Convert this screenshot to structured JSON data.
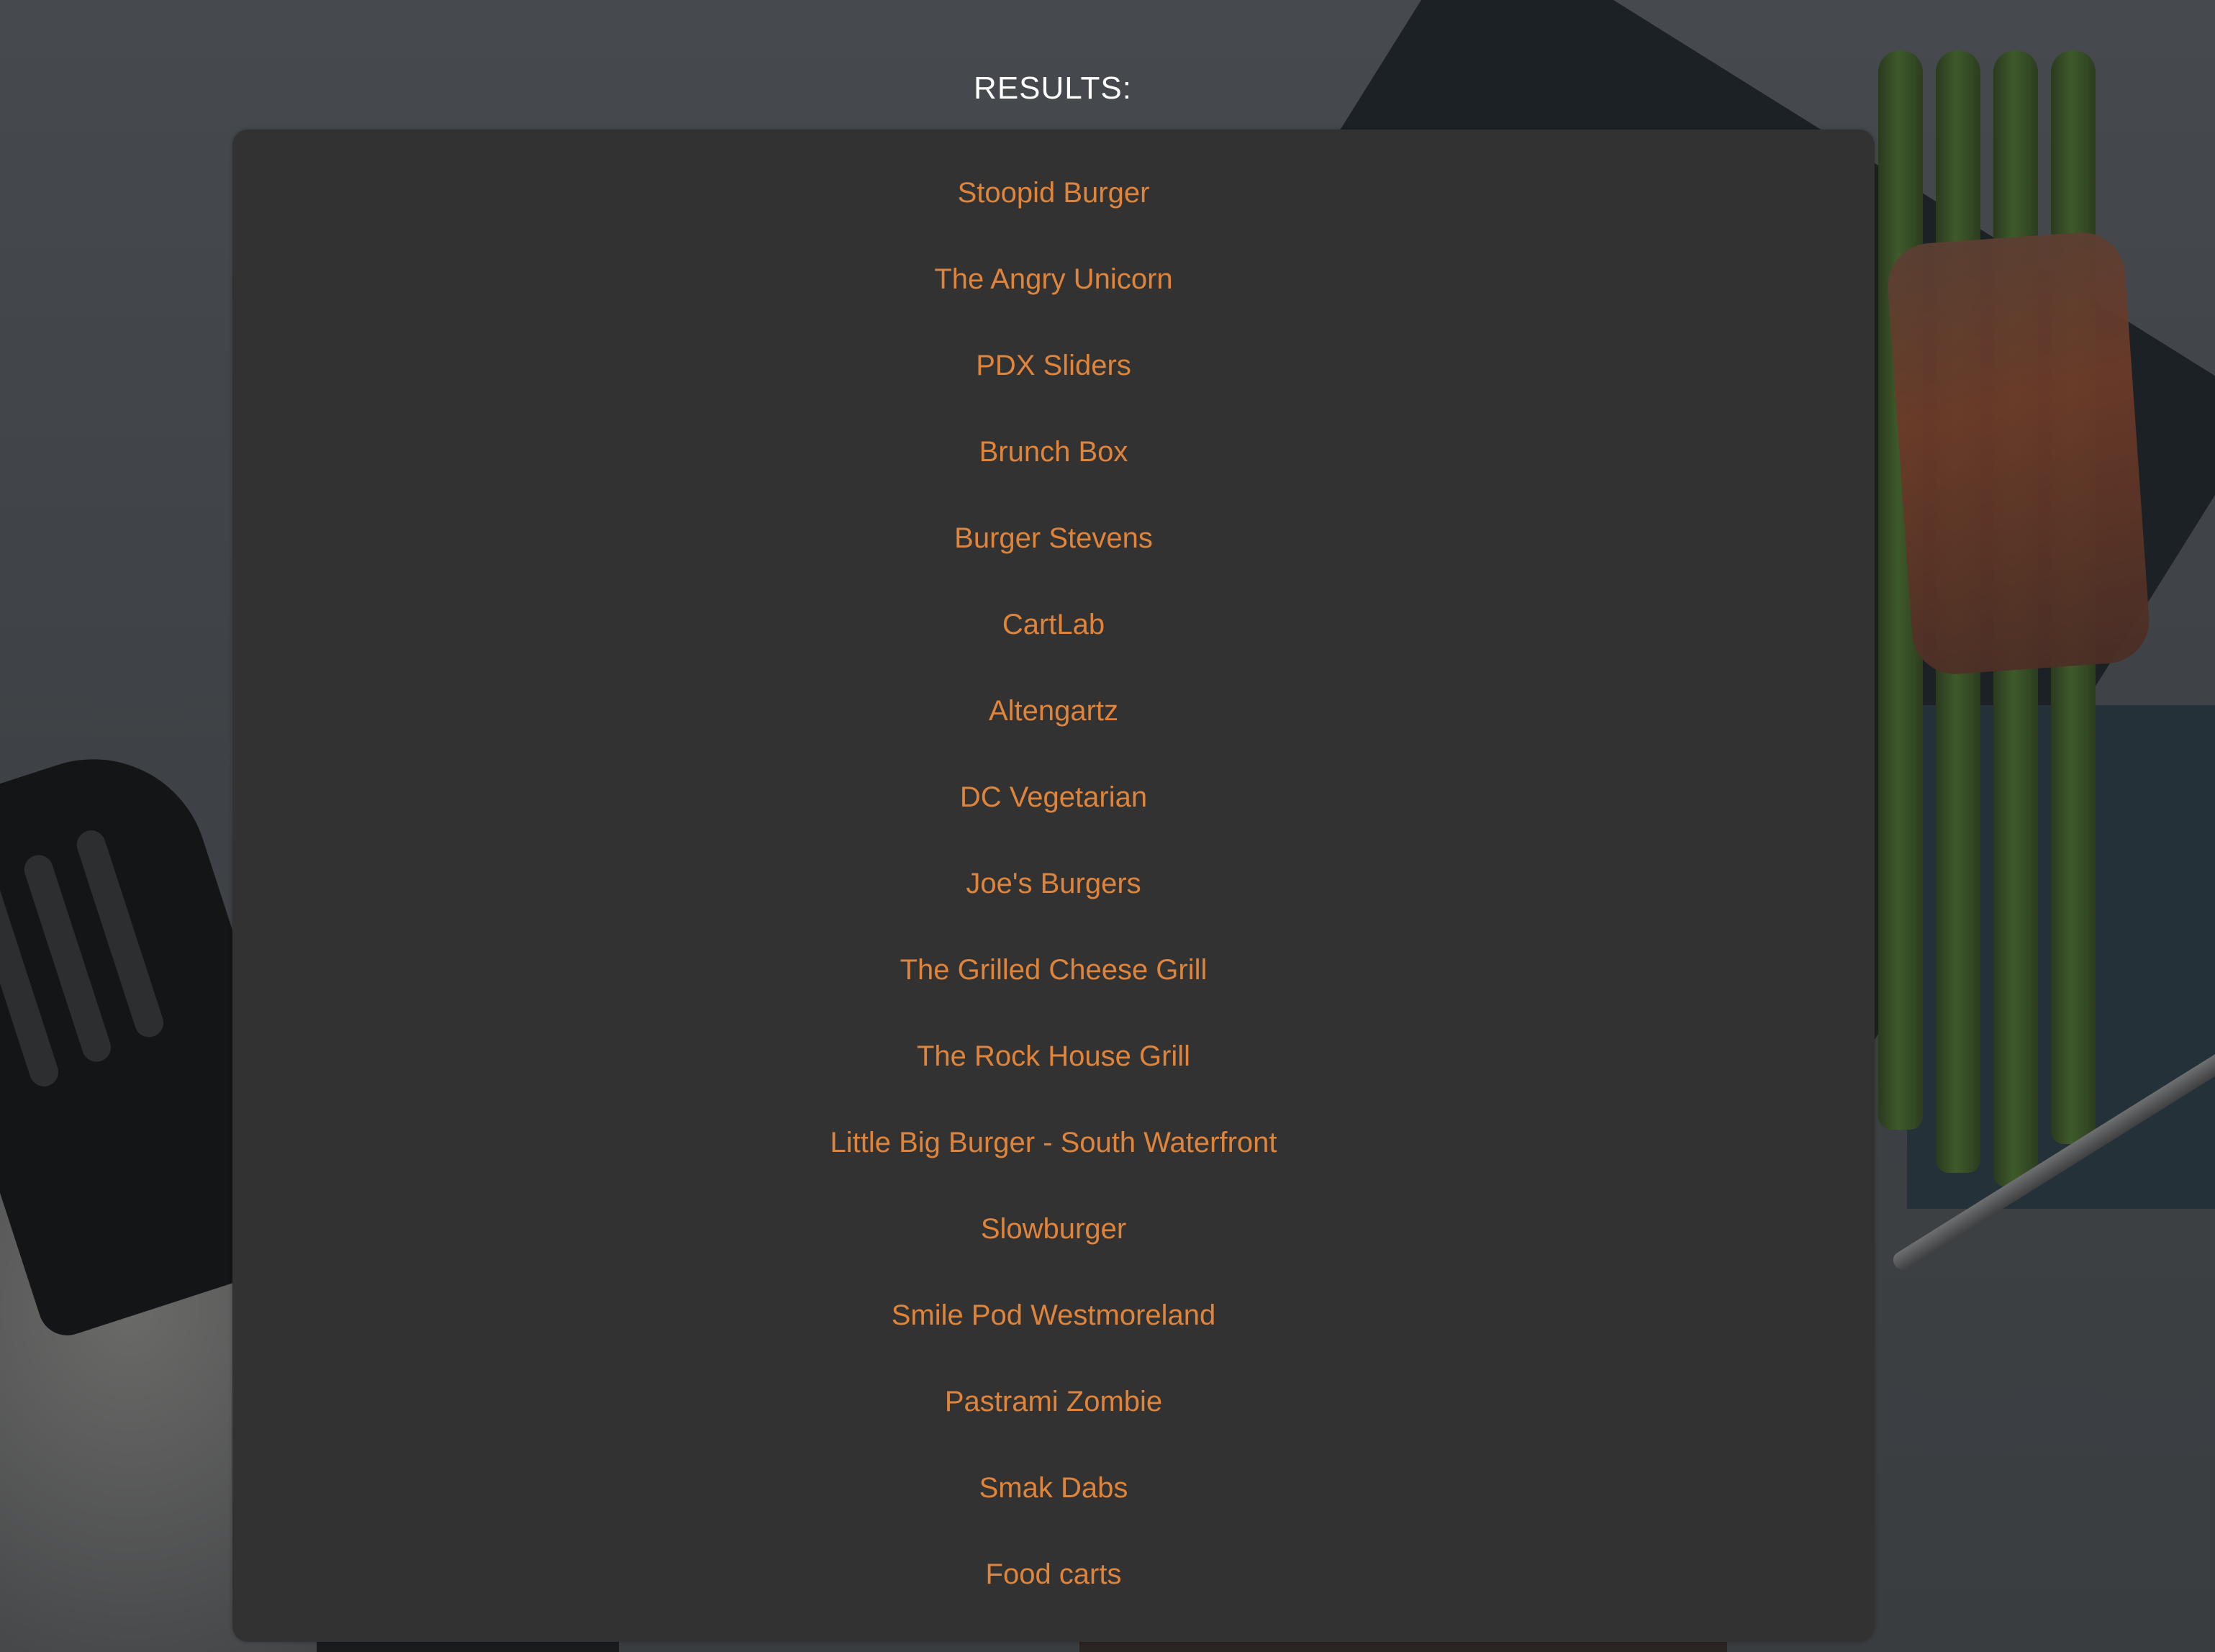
{
  "page": {
    "heading": "RESULTS:"
  },
  "colors": {
    "link": "#e0843a",
    "panel": "#323232",
    "heading": "#ffffff"
  },
  "results": [
    {
      "label": "Stoopid Burger"
    },
    {
      "label": "The Angry Unicorn"
    },
    {
      "label": "PDX Sliders"
    },
    {
      "label": "Brunch Box"
    },
    {
      "label": "Burger Stevens"
    },
    {
      "label": "CartLab"
    },
    {
      "label": "Altengartz"
    },
    {
      "label": "DC Vegetarian"
    },
    {
      "label": "Joe's Burgers"
    },
    {
      "label": "The Grilled Cheese Grill"
    },
    {
      "label": "The Rock House Grill"
    },
    {
      "label": "Little Big Burger - South Waterfront"
    },
    {
      "label": "Slowburger"
    },
    {
      "label": "Smile Pod Westmoreland"
    },
    {
      "label": "Pastrami Zombie"
    },
    {
      "label": "Smak Dabs"
    },
    {
      "label": "Food carts"
    }
  ]
}
